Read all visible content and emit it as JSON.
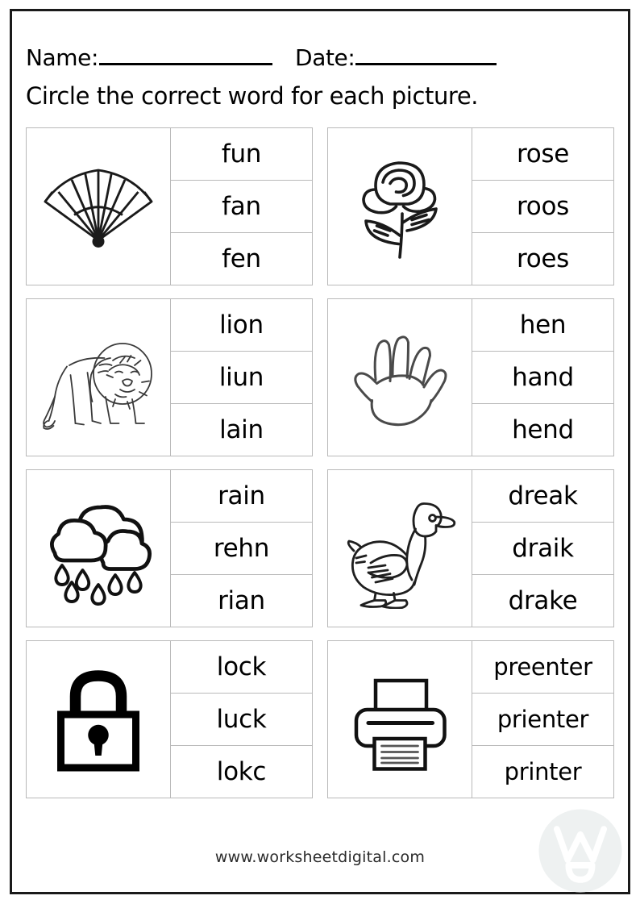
{
  "header": {
    "name_label": "Name:",
    "date_label": "Date:",
    "instruction": "Circle the correct word for each picture."
  },
  "footer": {
    "site": "www.worksheetdigital.com",
    "watermark_letter": "W"
  },
  "colors": {
    "ink": "#000000",
    "cell_border": "#b9b9b9",
    "page_border": "#1a1a1a",
    "watermark": "#eef1f1"
  },
  "items": [
    {
      "picture": "fan-icon",
      "picture_label": "fan",
      "choices": [
        "fun",
        "fan",
        "fen"
      ]
    },
    {
      "picture": "rose-icon",
      "picture_label": "rose",
      "choices": [
        "rose",
        "roos",
        "roes"
      ]
    },
    {
      "picture": "lion-icon",
      "picture_label": "lion",
      "choices": [
        "lion",
        "liun",
        "lain"
      ]
    },
    {
      "picture": "hand-icon",
      "picture_label": "hand",
      "choices": [
        "hen",
        "hand",
        "hend"
      ]
    },
    {
      "picture": "rain-cloud-icon",
      "picture_label": "rain",
      "choices": [
        "rain",
        "rehn",
        "rian"
      ]
    },
    {
      "picture": "duck-icon",
      "picture_label": "drake",
      "choices": [
        "dreak",
        "draik",
        "drake"
      ]
    },
    {
      "picture": "padlock-icon",
      "picture_label": "lock",
      "choices": [
        "lock",
        "luck",
        "lokc"
      ]
    },
    {
      "picture": "printer-icon",
      "picture_label": "printer",
      "choices": [
        "preenter",
        "prienter",
        "printer"
      ]
    }
  ]
}
